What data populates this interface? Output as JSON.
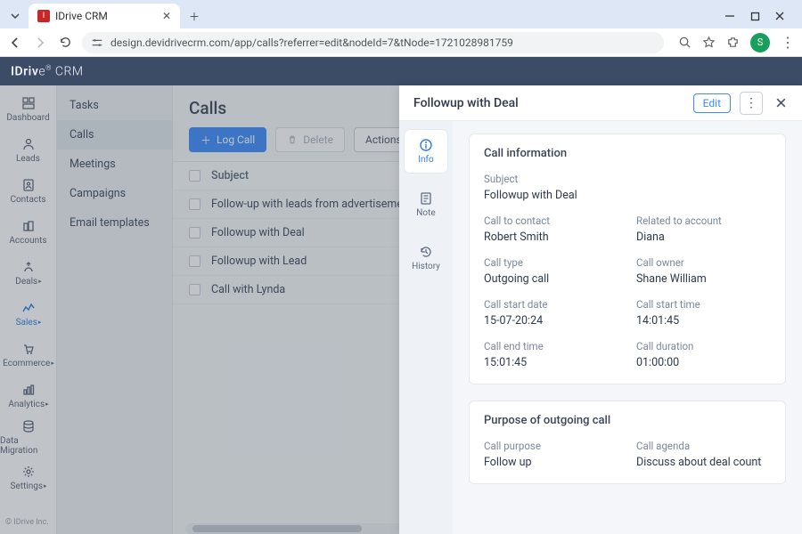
{
  "browser": {
    "tab_title": "IDrive CRM",
    "url": "design.devidrivecrm.com/app/calls?referrer=edit&nodeId=7&tNode=1721028981759",
    "profile_initial": "S"
  },
  "brand": {
    "part1": "IDriv",
    "part2": "e",
    "part3": " CRM",
    "super": "®"
  },
  "rail": {
    "items": [
      {
        "label": "Dashboard",
        "caret": false
      },
      {
        "label": "Leads",
        "caret": false
      },
      {
        "label": "Contacts",
        "caret": false
      },
      {
        "label": "Accounts",
        "caret": false
      },
      {
        "label": "Deals",
        "caret": true
      },
      {
        "label": "Sales",
        "caret": true,
        "active": true
      },
      {
        "label": "Ecommerce",
        "caret": true
      },
      {
        "label": "Analytics",
        "caret": true
      },
      {
        "label": "Data Migration",
        "caret": false
      },
      {
        "label": "Settings",
        "caret": true
      }
    ],
    "footer": "© IDrive Inc."
  },
  "subnav": {
    "items": [
      {
        "label": "Tasks"
      },
      {
        "label": "Calls",
        "active": true
      },
      {
        "label": "Meetings"
      },
      {
        "label": "Campaigns"
      },
      {
        "label": "Email templates"
      }
    ]
  },
  "main": {
    "title": "Calls",
    "log_call": "Log Call",
    "delete": "Delete",
    "actions": "Actions",
    "column_header": "Subject",
    "rows": [
      "Follow-up with leads from advertisement",
      "Followup with Deal",
      "Followup with Lead",
      "Call with Lynda"
    ]
  },
  "panel": {
    "title": "Followup with Deal",
    "edit": "Edit",
    "tabs": {
      "info": "Info",
      "note": "Note",
      "history": "History"
    },
    "card1_title": "Call information",
    "card2_title": "Purpose of outgoing call",
    "fields": {
      "subject_l": "Subject",
      "subject_v": "Followup with Deal",
      "contact_l": "Call to contact",
      "contact_v": "Robert Smith",
      "account_l": "Related to account",
      "account_v": "Diana",
      "type_l": "Call type",
      "type_v": "Outgoing call",
      "owner_l": "Call owner",
      "owner_v": "Shane William",
      "startdate_l": "Call start date",
      "startdate_v": "15-07-20:24",
      "starttime_l": "Call start time",
      "starttime_v": "14:01:45",
      "endtime_l": "Call end time",
      "endtime_v": "15:01:45",
      "duration_l": "Call duration",
      "duration_v": "01:00:00",
      "purpose_l": "Call purpose",
      "purpose_v": "Follow up",
      "agenda_l": "Call agenda",
      "agenda_v": "Discuss about deal count"
    }
  }
}
